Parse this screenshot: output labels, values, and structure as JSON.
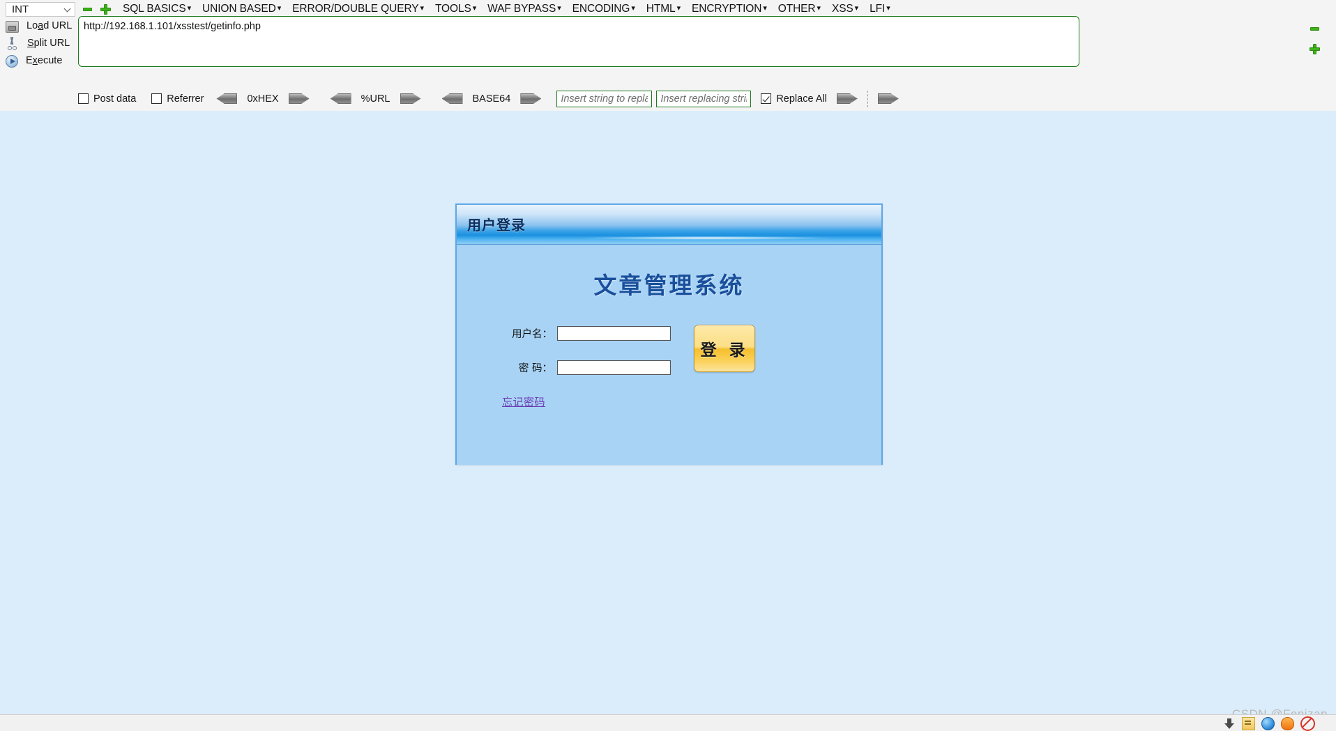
{
  "hackbar": {
    "type_selector": {
      "value": "INT",
      "icon": "chevron-down-icon"
    },
    "add_remove": {
      "remove_icon": "minus-icon",
      "add_icon": "plus-icon"
    },
    "menus": [
      {
        "label": "SQL BASICS",
        "caret": "▾"
      },
      {
        "label": "UNION BASED",
        "caret": "▾"
      },
      {
        "label": "ERROR/DOUBLE QUERY",
        "caret": "▾"
      },
      {
        "label": "TOOLS",
        "caret": "▾"
      },
      {
        "label": "WAF BYPASS",
        "caret": "▾"
      },
      {
        "label": "ENCODING",
        "caret": "▾"
      },
      {
        "label": "HTML",
        "caret": "▾"
      },
      {
        "label": "ENCRYPTION",
        "caret": "▾"
      },
      {
        "label": "OTHER",
        "caret": "▾"
      },
      {
        "label": "XSS",
        "caret": "▾"
      },
      {
        "label": "LFI",
        "caret": "▾"
      }
    ],
    "actions": [
      {
        "label_pre": "Lo",
        "label_key": "a",
        "label_post": "d URL",
        "icon": "load-url-icon"
      },
      {
        "label_pre": "",
        "label_key": "S",
        "label_post": "plit URL",
        "icon": "split-url-icon"
      },
      {
        "label_pre": "E",
        "label_key": "x",
        "label_post": "ecute",
        "icon": "execute-icon"
      }
    ],
    "url_field": {
      "value": "http://192.168.1.101/xsstest/getinfo.php",
      "placeholder": ""
    },
    "options": {
      "post_data": {
        "label": "Post data",
        "checked": false
      },
      "referrer": {
        "label": "Referrer",
        "checked": false
      },
      "encoders": [
        {
          "label": "0xHEX"
        },
        {
          "label": "%URL"
        },
        {
          "label": "BASE64"
        }
      ],
      "replace_from": {
        "value": "",
        "placeholder": "Insert string to replace"
      },
      "replace_to": {
        "value": "",
        "placeholder": "Insert replacing string"
      },
      "replace_all": {
        "label": "Replace All",
        "checked": true
      }
    }
  },
  "page": {
    "background_color": "#dbedfb",
    "login_panel": {
      "header_title": "用户登录",
      "system_title": "文章管理系统",
      "fields": [
        {
          "label": "用户名：",
          "value": "",
          "name": "username"
        },
        {
          "label": "密 码：",
          "value": "",
          "name": "password"
        }
      ],
      "submit_label": "登 录",
      "forgot_label": "忘记密码",
      "accent_border": "#5ea7e4",
      "body_color": "#a8d3f5",
      "button_color": "#f6bf2e",
      "link_color": "#6a3ab2"
    }
  },
  "watermark": {
    "text": "CSDN @Fenizap"
  }
}
